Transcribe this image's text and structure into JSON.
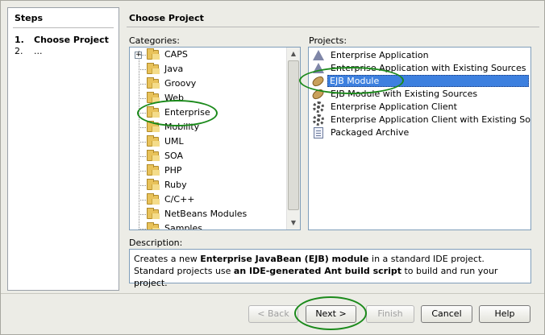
{
  "steps": {
    "title": "Steps",
    "items": [
      {
        "num": "1.",
        "label": "Choose Project"
      },
      {
        "num": "2.",
        "label": "..."
      }
    ]
  },
  "panel": {
    "title": "Choose Project",
    "categories_label": "Categories:",
    "projects_label": "Projects:",
    "description_label": "Description:"
  },
  "categories": [
    {
      "label": "CAPS"
    },
    {
      "label": "Java"
    },
    {
      "label": "Groovy"
    },
    {
      "label": "Web"
    },
    {
      "label": "Enterprise"
    },
    {
      "label": "Mobility"
    },
    {
      "label": "UML"
    },
    {
      "label": "SOA"
    },
    {
      "label": "PHP"
    },
    {
      "label": "Ruby"
    },
    {
      "label": "C/C++"
    },
    {
      "label": "NetBeans Modules"
    },
    {
      "label": "Samples"
    }
  ],
  "selected_category": "Enterprise",
  "projects": [
    {
      "label": "Enterprise Application",
      "icon": "enterprise-app-icon"
    },
    {
      "label": "Enterprise Application with Existing Sources",
      "icon": "enterprise-app-icon"
    },
    {
      "label": "EJB Module",
      "icon": "bean-icon"
    },
    {
      "label": "EJB Module with Existing Sources",
      "icon": "bean-icon"
    },
    {
      "label": "Enterprise Application Client",
      "icon": "gear-icon"
    },
    {
      "label": "Enterprise Application Client with Existing Sources",
      "icon": "gear-icon"
    },
    {
      "label": "Packaged Archive",
      "icon": "document-icon"
    }
  ],
  "selected_project": "EJB Module",
  "description": {
    "part1": "Creates a new ",
    "bold1": "Enterprise JavaBean (EJB) module",
    "part2": " in a standard IDE project. Standard projects use ",
    "bold2": "an IDE-generated Ant build script",
    "part3": " to build and run your project."
  },
  "buttons": {
    "back": "< Back",
    "next": "Next >",
    "finish": "Finish",
    "cancel": "Cancel",
    "help": "Help"
  },
  "colors": {
    "selection": "#3d80df",
    "highlight_circle": "#1b8a1b"
  }
}
